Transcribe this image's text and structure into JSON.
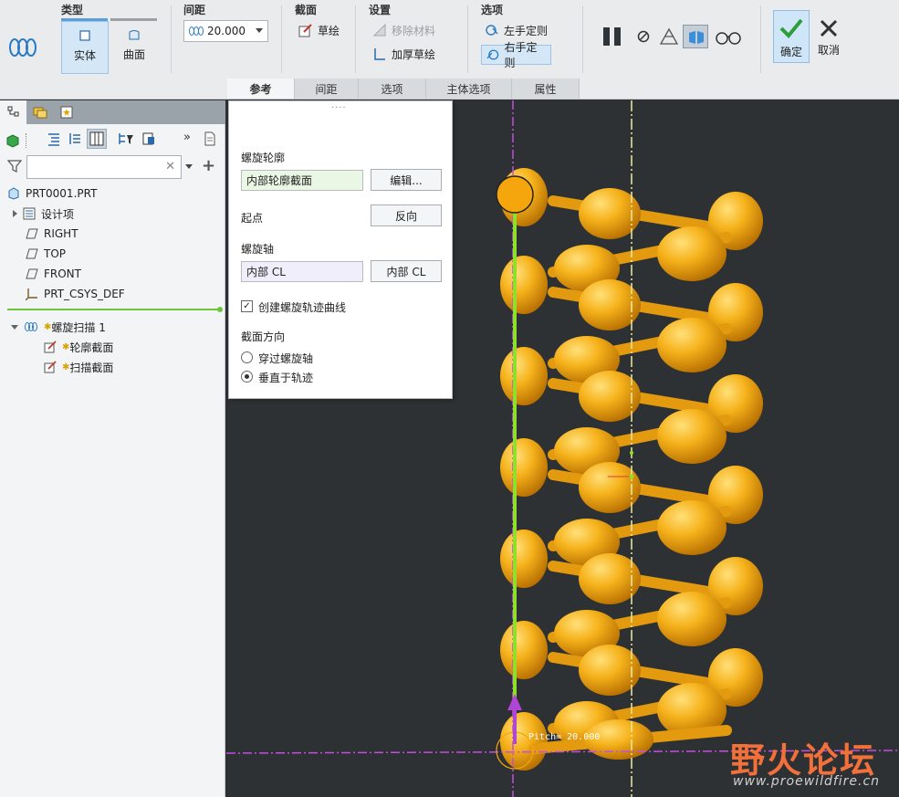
{
  "ribbon": {
    "groups": {
      "type": "类型",
      "pitch": "间距",
      "section": "截面",
      "settings": "设置",
      "options": "选项"
    },
    "solid_label": "实体",
    "surface_label": "曲面",
    "pitch_value": "20.000",
    "sketch_label": "草绘",
    "remove_material_label": "移除材料",
    "thicken_label": "加厚草绘",
    "left_hand_label": "左手定则",
    "right_hand_label": "右手定则",
    "ok_label": "确定",
    "cancel_label": "取消",
    "tabs": [
      {
        "label": "参考",
        "active": true
      },
      {
        "label": "间距",
        "active": false
      },
      {
        "label": "选项",
        "active": false
      },
      {
        "label": "主体选项",
        "active": false
      },
      {
        "label": "属性",
        "active": false
      }
    ]
  },
  "tree": {
    "root": "PRT0001.PRT",
    "items": [
      "设计项",
      "RIGHT",
      "TOP",
      "FRONT",
      "PRT_CSYS_DEF"
    ],
    "feature": "螺旋扫描 1",
    "sub_items": [
      "轮廓截面",
      "扫描截面"
    ]
  },
  "ref_panel": {
    "grip": "····",
    "profile_label": "螺旋轮廓",
    "profile_value": "内部轮廓截面",
    "edit_button": "编辑...",
    "start_label": "起点",
    "flip_button": "反向",
    "axis_label": "螺旋轴",
    "axis_value": "内部 CL",
    "axis_button": "内部 CL",
    "create_curve_label": "创建螺旋轨迹曲线",
    "create_curve_checked": true,
    "section_orient_label": "截面方向",
    "orient_options": [
      {
        "label": "穿过螺旋轴",
        "selected": false
      },
      {
        "label": "垂直于轨迹",
        "selected": true
      }
    ]
  },
  "viewport": {
    "pitch_annotation": "Pitch= 20.000",
    "watermark_title": "野火论坛",
    "watermark_url": "www.proewildfire.cn"
  },
  "colors": {
    "accent": "#f5a60c",
    "axis_purple": "#c44ee0",
    "trajectory_green": "#8fe02a",
    "datum_yellow": "#f0eaa0"
  }
}
